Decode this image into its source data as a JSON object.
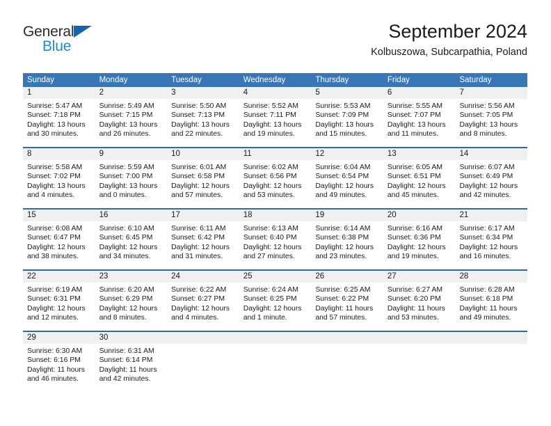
{
  "brand": {
    "name_top": "General",
    "name_bottom": "Blue",
    "accent_color": "#1e87d6",
    "triangle_color": "#1565a8"
  },
  "header": {
    "title": "September 2024",
    "subtitle": "Kolbuszowa, Subcarpathia, Poland"
  },
  "calendar": {
    "header_bg": "#3876b8",
    "row_border_color": "#2b6aab",
    "daynum_bg": "#f0f0f0",
    "weekdays": [
      "Sunday",
      "Monday",
      "Tuesday",
      "Wednesday",
      "Thursday",
      "Friday",
      "Saturday"
    ],
    "weeks": [
      [
        {
          "day": "1",
          "sunrise": "Sunrise: 5:47 AM",
          "sunset": "Sunset: 7:18 PM",
          "daylight": "Daylight: 13 hours and 30 minutes."
        },
        {
          "day": "2",
          "sunrise": "Sunrise: 5:49 AM",
          "sunset": "Sunset: 7:15 PM",
          "daylight": "Daylight: 13 hours and 26 minutes."
        },
        {
          "day": "3",
          "sunrise": "Sunrise: 5:50 AM",
          "sunset": "Sunset: 7:13 PM",
          "daylight": "Daylight: 13 hours and 22 minutes."
        },
        {
          "day": "4",
          "sunrise": "Sunrise: 5:52 AM",
          "sunset": "Sunset: 7:11 PM",
          "daylight": "Daylight: 13 hours and 19 minutes."
        },
        {
          "day": "5",
          "sunrise": "Sunrise: 5:53 AM",
          "sunset": "Sunset: 7:09 PM",
          "daylight": "Daylight: 13 hours and 15 minutes."
        },
        {
          "day": "6",
          "sunrise": "Sunrise: 5:55 AM",
          "sunset": "Sunset: 7:07 PM",
          "daylight": "Daylight: 13 hours and 11 minutes."
        },
        {
          "day": "7",
          "sunrise": "Sunrise: 5:56 AM",
          "sunset": "Sunset: 7:05 PM",
          "daylight": "Daylight: 13 hours and 8 minutes."
        }
      ],
      [
        {
          "day": "8",
          "sunrise": "Sunrise: 5:58 AM",
          "sunset": "Sunset: 7:02 PM",
          "daylight": "Daylight: 13 hours and 4 minutes."
        },
        {
          "day": "9",
          "sunrise": "Sunrise: 5:59 AM",
          "sunset": "Sunset: 7:00 PM",
          "daylight": "Daylight: 13 hours and 0 minutes."
        },
        {
          "day": "10",
          "sunrise": "Sunrise: 6:01 AM",
          "sunset": "Sunset: 6:58 PM",
          "daylight": "Daylight: 12 hours and 57 minutes."
        },
        {
          "day": "11",
          "sunrise": "Sunrise: 6:02 AM",
          "sunset": "Sunset: 6:56 PM",
          "daylight": "Daylight: 12 hours and 53 minutes."
        },
        {
          "day": "12",
          "sunrise": "Sunrise: 6:04 AM",
          "sunset": "Sunset: 6:54 PM",
          "daylight": "Daylight: 12 hours and 49 minutes."
        },
        {
          "day": "13",
          "sunrise": "Sunrise: 6:05 AM",
          "sunset": "Sunset: 6:51 PM",
          "daylight": "Daylight: 12 hours and 45 minutes."
        },
        {
          "day": "14",
          "sunrise": "Sunrise: 6:07 AM",
          "sunset": "Sunset: 6:49 PM",
          "daylight": "Daylight: 12 hours and 42 minutes."
        }
      ],
      [
        {
          "day": "15",
          "sunrise": "Sunrise: 6:08 AM",
          "sunset": "Sunset: 6:47 PM",
          "daylight": "Daylight: 12 hours and 38 minutes."
        },
        {
          "day": "16",
          "sunrise": "Sunrise: 6:10 AM",
          "sunset": "Sunset: 6:45 PM",
          "daylight": "Daylight: 12 hours and 34 minutes."
        },
        {
          "day": "17",
          "sunrise": "Sunrise: 6:11 AM",
          "sunset": "Sunset: 6:42 PM",
          "daylight": "Daylight: 12 hours and 31 minutes."
        },
        {
          "day": "18",
          "sunrise": "Sunrise: 6:13 AM",
          "sunset": "Sunset: 6:40 PM",
          "daylight": "Daylight: 12 hours and 27 minutes."
        },
        {
          "day": "19",
          "sunrise": "Sunrise: 6:14 AM",
          "sunset": "Sunset: 6:38 PM",
          "daylight": "Daylight: 12 hours and 23 minutes."
        },
        {
          "day": "20",
          "sunrise": "Sunrise: 6:16 AM",
          "sunset": "Sunset: 6:36 PM",
          "daylight": "Daylight: 12 hours and 19 minutes."
        },
        {
          "day": "21",
          "sunrise": "Sunrise: 6:17 AM",
          "sunset": "Sunset: 6:34 PM",
          "daylight": "Daylight: 12 hours and 16 minutes."
        }
      ],
      [
        {
          "day": "22",
          "sunrise": "Sunrise: 6:19 AM",
          "sunset": "Sunset: 6:31 PM",
          "daylight": "Daylight: 12 hours and 12 minutes."
        },
        {
          "day": "23",
          "sunrise": "Sunrise: 6:20 AM",
          "sunset": "Sunset: 6:29 PM",
          "daylight": "Daylight: 12 hours and 8 minutes."
        },
        {
          "day": "24",
          "sunrise": "Sunrise: 6:22 AM",
          "sunset": "Sunset: 6:27 PM",
          "daylight": "Daylight: 12 hours and 4 minutes."
        },
        {
          "day": "25",
          "sunrise": "Sunrise: 6:24 AM",
          "sunset": "Sunset: 6:25 PM",
          "daylight": "Daylight: 12 hours and 1 minute."
        },
        {
          "day": "26",
          "sunrise": "Sunrise: 6:25 AM",
          "sunset": "Sunset: 6:22 PM",
          "daylight": "Daylight: 11 hours and 57 minutes."
        },
        {
          "day": "27",
          "sunrise": "Sunrise: 6:27 AM",
          "sunset": "Sunset: 6:20 PM",
          "daylight": "Daylight: 11 hours and 53 minutes."
        },
        {
          "day": "28",
          "sunrise": "Sunrise: 6:28 AM",
          "sunset": "Sunset: 6:18 PM",
          "daylight": "Daylight: 11 hours and 49 minutes."
        }
      ],
      [
        {
          "day": "29",
          "sunrise": "Sunrise: 6:30 AM",
          "sunset": "Sunset: 6:16 PM",
          "daylight": "Daylight: 11 hours and 46 minutes."
        },
        {
          "day": "30",
          "sunrise": "Sunrise: 6:31 AM",
          "sunset": "Sunset: 6:14 PM",
          "daylight": "Daylight: 11 hours and 42 minutes."
        },
        {
          "day": "",
          "sunrise": "",
          "sunset": "",
          "daylight": ""
        },
        {
          "day": "",
          "sunrise": "",
          "sunset": "",
          "daylight": ""
        },
        {
          "day": "",
          "sunrise": "",
          "sunset": "",
          "daylight": ""
        },
        {
          "day": "",
          "sunrise": "",
          "sunset": "",
          "daylight": ""
        },
        {
          "day": "",
          "sunrise": "",
          "sunset": "",
          "daylight": ""
        }
      ]
    ]
  }
}
